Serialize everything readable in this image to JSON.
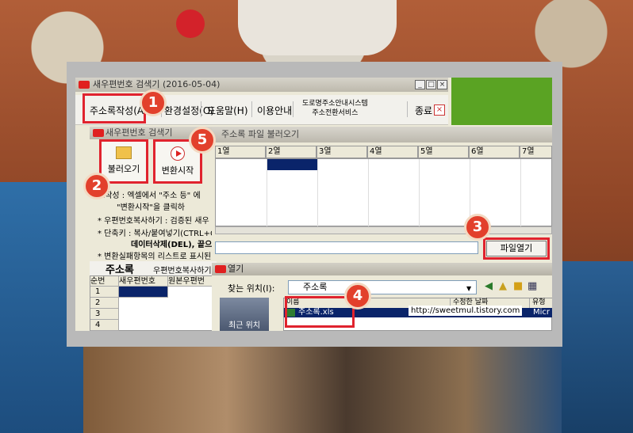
{
  "app": {
    "title": "새우편번호 검색기 (2016-05-04)",
    "inner_title": "새우편번호 검색기"
  },
  "window_buttons": {
    "minimize": "_",
    "maximize": "□",
    "close": "×"
  },
  "menu": {
    "items": [
      "주소록작성(A)",
      "환경설정(O)",
      "도움말(H)",
      "이용안내"
    ],
    "road_service_line1": "도로명주소안내시스템",
    "road_service_line2": "주소전환서비스",
    "exit_label": "종료"
  },
  "toolbar": {
    "load_label": "불러오기",
    "convert_label": "변환시작"
  },
  "description": {
    "line1": "소작성 : 엑셀에서 \"주소 등\" 에",
    "line2": "\"변환시작\"을 클릭하",
    "line3": "* 우편번호복사하기 : 검증된 새우",
    "line4": "* 단축키 : 복사/붙여넣기(CTRL+C",
    "line5": "데이터삭제(DEL), 끝으",
    "line6": "* 변환실패항목의 리스트로 표시된"
  },
  "tabs": {
    "address_book": "주소록",
    "postcode_copy": "우편번호복사하기"
  },
  "left_grid": {
    "headers": [
      "순번",
      "새우편번호",
      "원본우편번"
    ],
    "rows": [
      "1",
      "2",
      "3",
      "4"
    ]
  },
  "loader": {
    "title": "주소록 파일 불러오기",
    "columns": [
      "1열",
      "2열",
      "3열",
      "4열",
      "5열",
      "6열",
      "7열"
    ],
    "open_file_label": "파일열기"
  },
  "open_dialog": {
    "title": "열기",
    "look_in_label": "찾는 위치(I):",
    "look_in_value": "주소록",
    "recent_label": "최근 위치",
    "col_name": "이름",
    "col_modified": "수정한 날짜",
    "col_type": "유형",
    "file_name": "주소록.xls",
    "file_type_partial": "Micr"
  },
  "steps": [
    "1",
    "2",
    "3",
    "4",
    "5"
  ],
  "watermark": "http://sweetmul.tistory.com",
  "colors": {
    "accent_red": "#e0232e",
    "badge_orange": "#e2402c",
    "selection_blue": "#0a246a",
    "green_panel": "#5aa323"
  }
}
